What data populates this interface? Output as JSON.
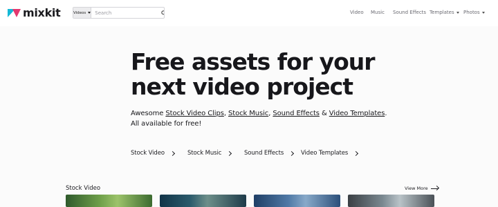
{
  "header": {
    "logo_text": "mixkit",
    "search": {
      "category": "Videos",
      "placeholder": "Search"
    },
    "nav": [
      {
        "label": "Video"
      },
      {
        "label": "Music"
      },
      {
        "label": "Sound Effects"
      },
      {
        "label": "Templates"
      },
      {
        "label": "Photos"
      }
    ]
  },
  "hero": {
    "title_line1": "Free assets for your",
    "title_line2": "next video project",
    "sub_prefix": "Awesome ",
    "link_video_clips": "Stock Video Clips",
    "sep1": ", ",
    "link_music": "Stock Music",
    "sep2": ", ",
    "link_sfx": "Sound Effects",
    "sep3": " & ",
    "link_templates": "Video Templates",
    "sub_suffix": ".",
    "sub_line2": "All available for free!"
  },
  "quick_links": [
    {
      "label": "Stock Video"
    },
    {
      "label": "Stock Music"
    },
    {
      "label": "Sound Effects"
    },
    {
      "label": "Video Templates"
    }
  ],
  "section": {
    "title": "Stock Video",
    "view_more": "View More"
  },
  "colors": {
    "logo_cyan": "#14b8d6",
    "logo_pink": "#e3386f",
    "text": "#17171b",
    "nav_text": "#6b6b72"
  }
}
